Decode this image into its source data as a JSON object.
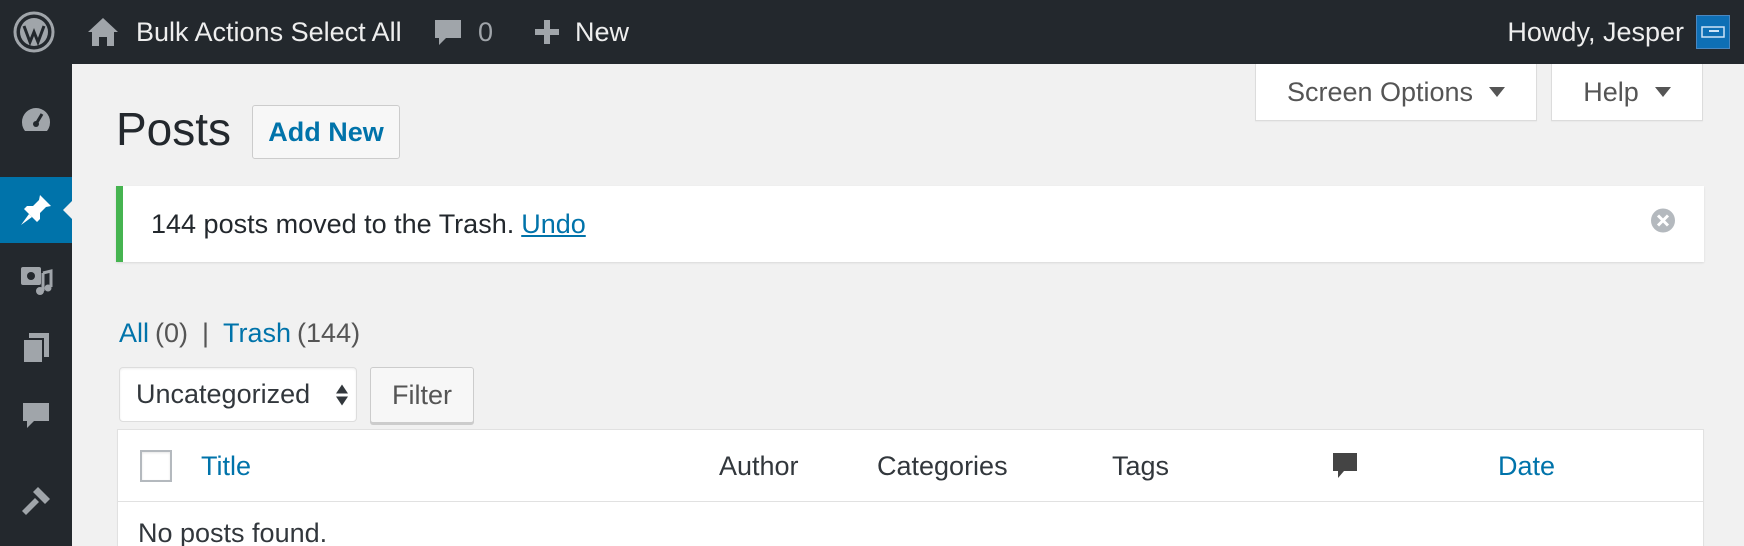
{
  "adminbar": {
    "site_name": "Bulk Actions Select All",
    "comments_count": "0",
    "new_label": "New",
    "greeting": "Howdy, Jesper"
  },
  "sidebar": {
    "items": [
      {
        "icon": "dashboard-icon",
        "active": false
      },
      {
        "icon": "posts-pin-icon",
        "active": true
      },
      {
        "icon": "media-icon",
        "active": false
      },
      {
        "icon": "pages-icon",
        "active": false
      },
      {
        "icon": "comments-icon",
        "active": false
      },
      {
        "icon": "appearance-brush-icon",
        "active": false
      }
    ]
  },
  "screen_meta": {
    "screen_options_label": "Screen Options",
    "help_label": "Help"
  },
  "page": {
    "title": "Posts",
    "add_new_label": "Add New"
  },
  "notice": {
    "message": "144 posts moved to the Trash.",
    "undo_label": "Undo",
    "accent_color": "#46b450"
  },
  "views": {
    "all_label": "All",
    "all_count": "(0)",
    "separator": "|",
    "trash_label": "Trash",
    "trash_count": "(144)"
  },
  "filters": {
    "category_selected": "Uncategorized",
    "filter_button_label": "Filter"
  },
  "table": {
    "columns": {
      "title": "Title",
      "author": "Author",
      "categories": "Categories",
      "tags": "Tags",
      "comments_icon": "comment-bubble-icon",
      "date": "Date"
    },
    "empty_message": "No posts found."
  },
  "colors": {
    "adminbar_bg": "#23282d",
    "link": "#0073aa",
    "active_menu": "#0073aa"
  }
}
